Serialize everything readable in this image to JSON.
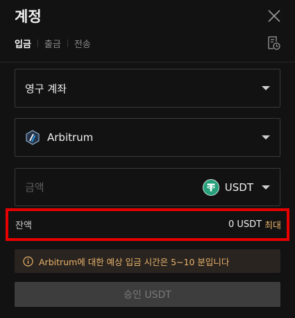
{
  "header": {
    "title": "계정",
    "close_icon": "close-icon"
  },
  "tabs": [
    {
      "label": "입금",
      "active": true
    },
    {
      "label": "출금",
      "active": false
    },
    {
      "label": "전송",
      "active": false
    }
  ],
  "history_icon": "history-icon",
  "account_select": {
    "value": "영구 계좌"
  },
  "network_select": {
    "value": "Arbitrum",
    "icon": "arbitrum-icon"
  },
  "amount": {
    "placeholder": "금액",
    "value": "",
    "currency": "USDT",
    "currency_icon": "tether-icon"
  },
  "balance": {
    "label": "잔액",
    "value": "0 USDT",
    "max_label": "최대"
  },
  "notice": {
    "icon": "info-icon",
    "text": "Arbitrum에 대한 예상 입금 시간은 5~10 분입니다"
  },
  "approve_button": {
    "label": "승인 USDT",
    "enabled": false
  },
  "colors": {
    "background": "#121212",
    "accent": "#e8b36b",
    "highlight_border": "#e60000",
    "tether_green": "#26a17b",
    "arbitrum_blue": "#28a0f0"
  }
}
